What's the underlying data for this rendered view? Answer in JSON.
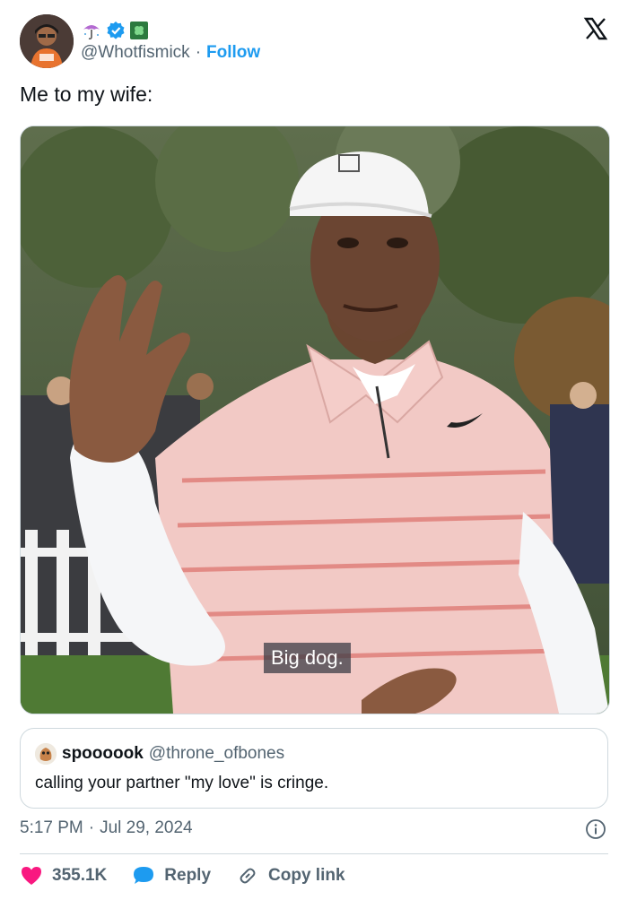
{
  "header": {
    "handle": "@Whotfismick",
    "separator": "·",
    "follow_label": "Follow",
    "name_icons": [
      "umbrella-emoji-icon",
      "verified-badge-icon",
      "clover-emoji-icon"
    ]
  },
  "tweet": {
    "text": "Me to my wife:",
    "media_caption": "Big dog."
  },
  "quote": {
    "name": "spoooook",
    "handle": "@throne_ofbones",
    "text": "calling your partner \"my love\" is cringe."
  },
  "meta": {
    "time": "5:17 PM",
    "separator": "·",
    "date": "Jul 29, 2024"
  },
  "actions": {
    "likes": "355.1K",
    "reply_label": "Reply",
    "copy_link_label": "Copy link"
  },
  "colors": {
    "accent": "#1d9bf0",
    "like": "#f91880",
    "text": "#0f1419",
    "muted": "#536471",
    "border": "#cfd9de"
  }
}
